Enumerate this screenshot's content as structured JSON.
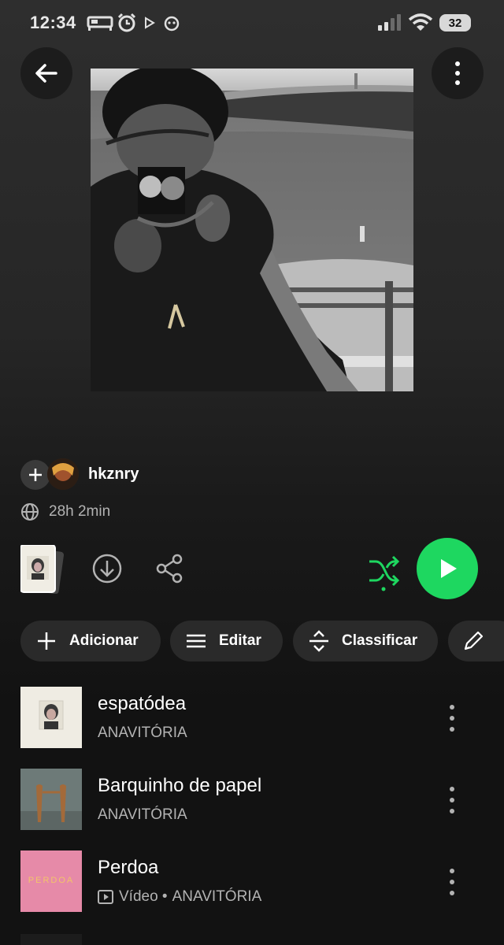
{
  "status_bar": {
    "time": "12:34",
    "battery": "32",
    "icons": [
      "bed-icon",
      "alarm-icon",
      "play-notification-icon",
      "app-notification-icon",
      "signal-icon",
      "wifi-icon",
      "battery-icon"
    ]
  },
  "header": {
    "back_icon": "arrow-left-icon",
    "more_icon": "vertical-dots-icon"
  },
  "playlist": {
    "owner": "hkznry",
    "duration": "28h 2min"
  },
  "actions": {
    "chips": [
      {
        "label": "Adicionar",
        "icon": "plus-icon"
      },
      {
        "label": "Editar",
        "icon": "lines-icon"
      },
      {
        "label": "Classificar",
        "icon": "sort-icon"
      },
      {
        "label": "",
        "icon": "pencil-icon"
      }
    ]
  },
  "colors": {
    "accent": "#1ed760",
    "background": "#121212",
    "chip": "#2a2a2a",
    "secondary_text": "#b3b3b3"
  },
  "tracks": [
    {
      "title": "espatódea",
      "artist": "ANAVITÓRIA",
      "video": false,
      "video_label": ""
    },
    {
      "title": "Barquinho de papel",
      "artist": "ANAVITÓRIA",
      "video": false,
      "video_label": ""
    },
    {
      "title": "Perdoa",
      "artist": "ANAVITÓRIA",
      "video": true,
      "video_label": "Vídeo •",
      "art_text": "PERDOA"
    }
  ]
}
